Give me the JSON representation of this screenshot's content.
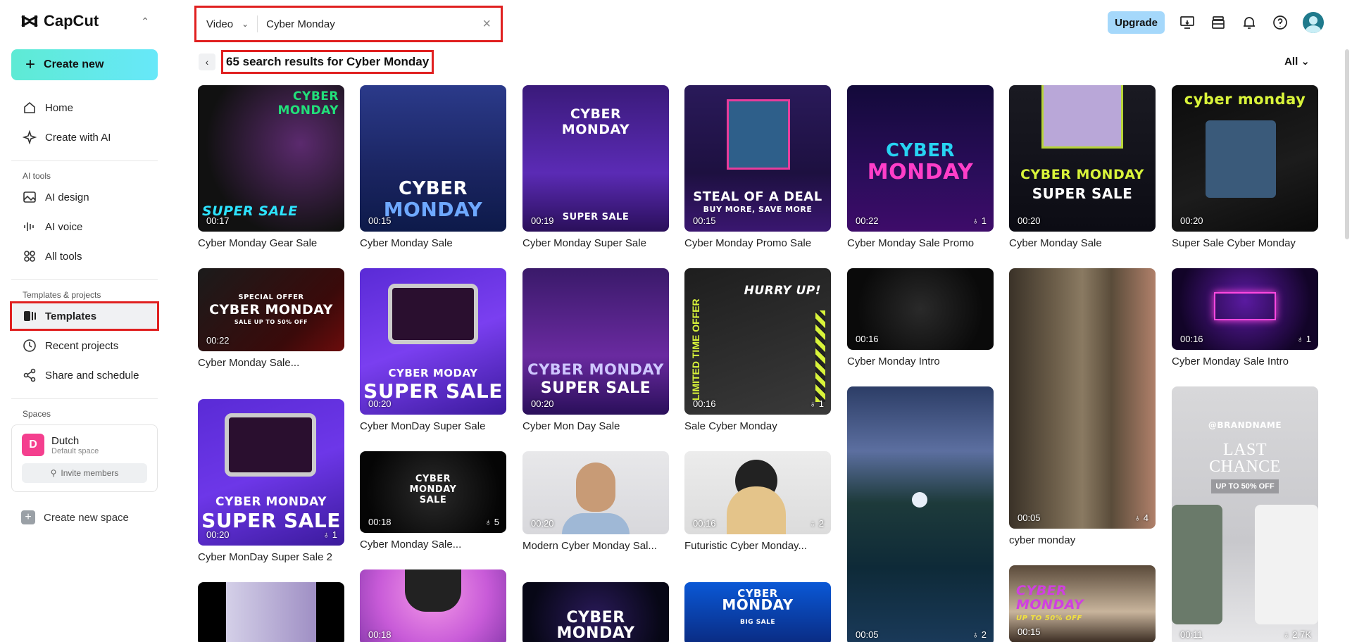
{
  "app": {
    "name": "CapCut"
  },
  "sidebar": {
    "create_label": "Create new",
    "items_top": [
      {
        "label": "Home",
        "icon": "home-icon"
      },
      {
        "label": "Create with AI",
        "icon": "sparkle-icon"
      }
    ],
    "ai_tools_label": "AI tools",
    "items_ai": [
      {
        "label": "AI design",
        "icon": "image-icon"
      },
      {
        "label": "AI voice",
        "icon": "waveform-icon"
      },
      {
        "label": "All tools",
        "icon": "grid-icon"
      }
    ],
    "templates_projects_label": "Templates & projects",
    "items_tp": [
      {
        "label": "Templates",
        "icon": "templates-icon"
      },
      {
        "label": "Recent projects",
        "icon": "clock-icon"
      },
      {
        "label": "Share and schedule",
        "icon": "share-icon"
      }
    ],
    "spaces_label": "Spaces",
    "space": {
      "initial": "D",
      "name": "Dutch",
      "subtitle": "Default space",
      "invite_label": "Invite members"
    },
    "new_space_label": "Create new space"
  },
  "search": {
    "type": "Video",
    "value": "Cyber Monday"
  },
  "topbar": {
    "upgrade_label": "Upgrade"
  },
  "results": {
    "title": "65 search results for Cyber Monday",
    "filter": "All"
  },
  "colors": {
    "accent_red": "#e02020",
    "create_gradient_start": "#5eead4",
    "upgrade_bg": "#a5d8fb"
  },
  "cards": [
    {
      "title": "Cyber Monday Gear Sale",
      "time": "00:17",
      "likes": ""
    },
    {
      "title": "Cyber Monday Sale",
      "time": "00:15",
      "likes": ""
    },
    {
      "title": "Cyber Monday Super Sale",
      "time": "00:19",
      "likes": ""
    },
    {
      "title": "Cyber Monday Promo Sale",
      "time": "00:15",
      "likes": ""
    },
    {
      "title": "Cyber Monday Sale Promo",
      "time": "00:22",
      "likes": "1"
    },
    {
      "title": "Cyber Monday Sale",
      "time": "00:20",
      "likes": ""
    },
    {
      "title": "Super Sale Cyber Monday",
      "time": "00:20",
      "likes": ""
    },
    {
      "title": "Cyber Monday Sale...",
      "time": "00:22",
      "likes": ""
    },
    {
      "title": "Cyber MonDay Super Sale",
      "time": "00:20",
      "likes": ""
    },
    {
      "title": "Cyber Mon Day Sale",
      "time": "00:20",
      "likes": ""
    },
    {
      "title": "Sale Cyber Monday",
      "time": "00:16",
      "likes": "1"
    },
    {
      "title": "Cyber Monday Intro",
      "time": "00:16",
      "likes": ""
    },
    {
      "title": "cyber monday",
      "time": "00:05",
      "likes": "4"
    },
    {
      "title": "Cyber Monday Sale Intro",
      "time": "00:16",
      "likes": "1"
    },
    {
      "title": "Cyber MonDay Super Sale 2",
      "time": "00:20",
      "likes": "1"
    },
    {
      "title": "Cyber Monday Sale...",
      "time": "00:18",
      "likes": "5"
    },
    {
      "title": "Modern Cyber Monday Sal...",
      "time": "00:20",
      "likes": ""
    },
    {
      "title": "Futuristic Cyber Monday...",
      "time": "00:16",
      "likes": "2"
    },
    {
      "title": "",
      "time": "00:05",
      "likes": "2"
    },
    {
      "title": "",
      "time": "00:11",
      "likes": "2.7K"
    },
    {
      "title": "",
      "time": "",
      "likes": ""
    },
    {
      "title": "",
      "time": "00:18",
      "likes": ""
    },
    {
      "title": "",
      "time": "",
      "likes": ""
    },
    {
      "title": "",
      "time": "",
      "likes": ""
    },
    {
      "title": "",
      "time": "00:15",
      "likes": ""
    }
  ],
  "thumb_text": {
    "c0a": "CYBER",
    "c0b": "MONDAY",
    "c0c": "SUPER SALE",
    "c1a": "CYBER",
    "c1b": "MONDAY",
    "c2a": "CYBER",
    "c2b": "MONDAY",
    "c2c": "SUPER SALE",
    "c3a": "STEAL OF A DEAL",
    "c3b": "BUY MORE, SAVE MORE",
    "c4a": "CYBER",
    "c4b": "MONDAY",
    "c5a": "CYBER MONDAY",
    "c5b": "SUPER SALE",
    "c6a": "cyber monday",
    "c7a": "CYBER MONDAY",
    "c7b": "SALE UP TO 50% OFF",
    "c7c": "SPECIAL OFFER",
    "c8a": "CYBER MODAY",
    "c8b": "SUPER SALE",
    "c9a": "CYBER MONDAY",
    "c9b": "SUPER SALE",
    "c10a": "HURRY UP!",
    "c10b": "LIMITED TIME OFFER",
    "c14a": "CYBER MONDAY",
    "c14b": "SUPER SALE",
    "c15a": "CYBER",
    "c15b": "MONDAY",
    "c15c": "SALE",
    "c19a": "@BRANDNAME",
    "c19b": "LAST",
    "c19c": "CHANCE",
    "c19d": "UP TO 50% OFF",
    "c22a": "CYBER",
    "c22b": "MONDAY",
    "c23a": "CYBER",
    "c23b": "MONDAY",
    "c23c": "BIG SALE",
    "c24a": "CYBER",
    "c24b": "MONDAY",
    "c24c": "UP TO 50% OFF"
  }
}
